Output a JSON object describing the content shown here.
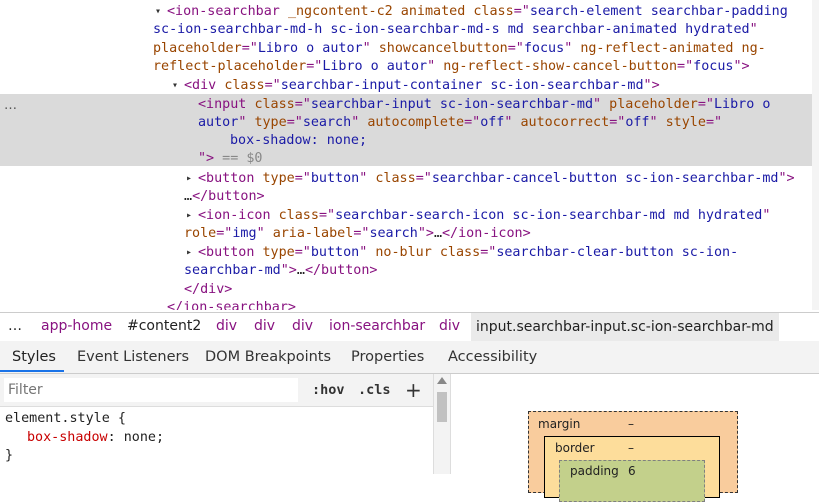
{
  "elements_tree": {
    "lines": [
      [
        {
          "t": "<ion-searchbar ",
          "c": "tag"
        },
        {
          "t": "_ngcontent-c2 animated ",
          "c": "attr"
        },
        {
          "t": "class",
          "c": "attr"
        },
        {
          "t": "=\"",
          "c": "tag"
        },
        {
          "t": "search-element searchbar-padding",
          "c": "val"
        }
      ],
      [
        {
          "t": "sc-ion-searchbar-md-h sc-ion-searchbar-md-s md searchbar-animated hydrated",
          "c": "val"
        },
        {
          "t": "\"",
          "c": "tag"
        }
      ],
      [
        {
          "t": "placeholder",
          "c": "attr"
        },
        {
          "t": "=\"",
          "c": "tag"
        },
        {
          "t": "Libro o autor",
          "c": "val"
        },
        {
          "t": "\" ",
          "c": "tag"
        },
        {
          "t": "showcancelbutton",
          "c": "attr"
        },
        {
          "t": "=\"",
          "c": "tag"
        },
        {
          "t": "focus",
          "c": "val"
        },
        {
          "t": "\" ",
          "c": "tag"
        },
        {
          "t": "ng-reflect-animated",
          "c": "attr"
        },
        {
          "t": " ng-",
          "c": "attr"
        }
      ],
      [
        {
          "t": "reflect-placeholder",
          "c": "attr"
        },
        {
          "t": "=\"",
          "c": "tag"
        },
        {
          "t": "Libro o autor",
          "c": "val"
        },
        {
          "t": "\" ",
          "c": "tag"
        },
        {
          "t": "ng-reflect-show-cancel-button",
          "c": "attr"
        },
        {
          "t": "=\"",
          "c": "tag"
        },
        {
          "t": "focus",
          "c": "val"
        },
        {
          "t": "\">",
          "c": "tag"
        }
      ],
      [
        {
          "t": "<div ",
          "c": "tag"
        },
        {
          "t": "class",
          "c": "attr"
        },
        {
          "t": "=\"",
          "c": "tag"
        },
        {
          "t": "searchbar-input-container sc-ion-searchbar-md",
          "c": "val"
        },
        {
          "t": "\">",
          "c": "tag"
        }
      ],
      [
        {
          "t": "<input ",
          "c": "tag"
        },
        {
          "t": "class",
          "c": "attr"
        },
        {
          "t": "=\"",
          "c": "tag"
        },
        {
          "t": "searchbar-input sc-ion-searchbar-md",
          "c": "val"
        },
        {
          "t": "\" ",
          "c": "tag"
        },
        {
          "t": "placeholder",
          "c": "attr"
        },
        {
          "t": "=\"",
          "c": "tag"
        },
        {
          "t": "Libro o",
          "c": "val"
        }
      ],
      [
        {
          "t": "autor",
          "c": "val"
        },
        {
          "t": "\" ",
          "c": "tag"
        },
        {
          "t": "type",
          "c": "attr"
        },
        {
          "t": "=\"",
          "c": "tag"
        },
        {
          "t": "search",
          "c": "val"
        },
        {
          "t": "\" ",
          "c": "tag"
        },
        {
          "t": "autocomplete",
          "c": "attr"
        },
        {
          "t": "=\"",
          "c": "tag"
        },
        {
          "t": "off",
          "c": "val"
        },
        {
          "t": "\" ",
          "c": "tag"
        },
        {
          "t": "autocorrect",
          "c": "attr"
        },
        {
          "t": "=\"",
          "c": "tag"
        },
        {
          "t": "off",
          "c": "val"
        },
        {
          "t": "\" ",
          "c": "tag"
        },
        {
          "t": "style",
          "c": "attr"
        },
        {
          "t": "=\"",
          "c": "tag"
        }
      ],
      [
        {
          "t": "box-shadow: none;",
          "c": "val"
        }
      ],
      [
        {
          "t": "\">",
          "c": "tag"
        },
        {
          "t": " == $0",
          "c": "dim"
        }
      ],
      [
        {
          "t": "<button ",
          "c": "tag"
        },
        {
          "t": "type",
          "c": "attr"
        },
        {
          "t": "=\"",
          "c": "tag"
        },
        {
          "t": "button",
          "c": "val"
        },
        {
          "t": "\" ",
          "c": "tag"
        },
        {
          "t": "class",
          "c": "attr"
        },
        {
          "t": "=\"",
          "c": "tag"
        },
        {
          "t": "searchbar-cancel-button sc-ion-searchbar-md",
          "c": "val"
        },
        {
          "t": "\">",
          "c": "tag"
        }
      ],
      [
        {
          "t": "…",
          "c": "txt"
        },
        {
          "t": "</button>",
          "c": "tag"
        }
      ],
      [
        {
          "t": "<ion-icon ",
          "c": "tag"
        },
        {
          "t": "class",
          "c": "attr"
        },
        {
          "t": "=\"",
          "c": "tag"
        },
        {
          "t": "searchbar-search-icon sc-ion-searchbar-md md hydrated",
          "c": "val"
        },
        {
          "t": "\"",
          "c": "tag"
        }
      ],
      [
        {
          "t": "role",
          "c": "attr"
        },
        {
          "t": "=\"",
          "c": "tag"
        },
        {
          "t": "img",
          "c": "val"
        },
        {
          "t": "\" ",
          "c": "tag"
        },
        {
          "t": "aria-label",
          "c": "attr"
        },
        {
          "t": "=\"",
          "c": "tag"
        },
        {
          "t": "search",
          "c": "val"
        },
        {
          "t": "\">",
          "c": "tag"
        },
        {
          "t": "…",
          "c": "txt"
        },
        {
          "t": "</ion-icon>",
          "c": "tag"
        }
      ],
      [
        {
          "t": "<button ",
          "c": "tag"
        },
        {
          "t": "type",
          "c": "attr"
        },
        {
          "t": "=\"",
          "c": "tag"
        },
        {
          "t": "button",
          "c": "val"
        },
        {
          "t": "\" ",
          "c": "tag"
        },
        {
          "t": "no-blur ",
          "c": "attr"
        },
        {
          "t": "class",
          "c": "attr"
        },
        {
          "t": "=\"",
          "c": "tag"
        },
        {
          "t": "searchbar-clear-button sc-ion-",
          "c": "val"
        }
      ],
      [
        {
          "t": "searchbar-md",
          "c": "val"
        },
        {
          "t": "\">",
          "c": "tag"
        },
        {
          "t": "…",
          "c": "txt"
        },
        {
          "t": "</button>",
          "c": "tag"
        }
      ],
      [
        {
          "t": "</div>",
          "c": "tag"
        }
      ],
      [
        {
          "t": "</ion-searchbar>",
          "c": "tag"
        }
      ]
    ],
    "selection_dots": "…"
  },
  "breadcrumbs": {
    "items": [
      "…",
      "app-home",
      "#content2",
      "div",
      "div",
      "div",
      "ion-searchbar",
      "div",
      "input.searchbar-input.sc-ion-searchbar-md"
    ]
  },
  "tabs": [
    "Styles",
    "Event Listeners",
    "DOM Breakpoints",
    "Properties",
    "Accessibility"
  ],
  "styles": {
    "filter_placeholder": "Filter",
    "hov_label": ":hov",
    "cls_label": ".cls",
    "add_rule_label": "+",
    "selector": "element.style",
    "open_brace": " {",
    "property": "box-shadow",
    "colon": ": ",
    "value": "none",
    "semicolon": ";",
    "close_brace": "}"
  },
  "box_model": {
    "margin_label": "margin",
    "margin_value": "–",
    "border_label": "border",
    "border_value": "–",
    "padding_label": "padding",
    "padding_value": "6"
  }
}
